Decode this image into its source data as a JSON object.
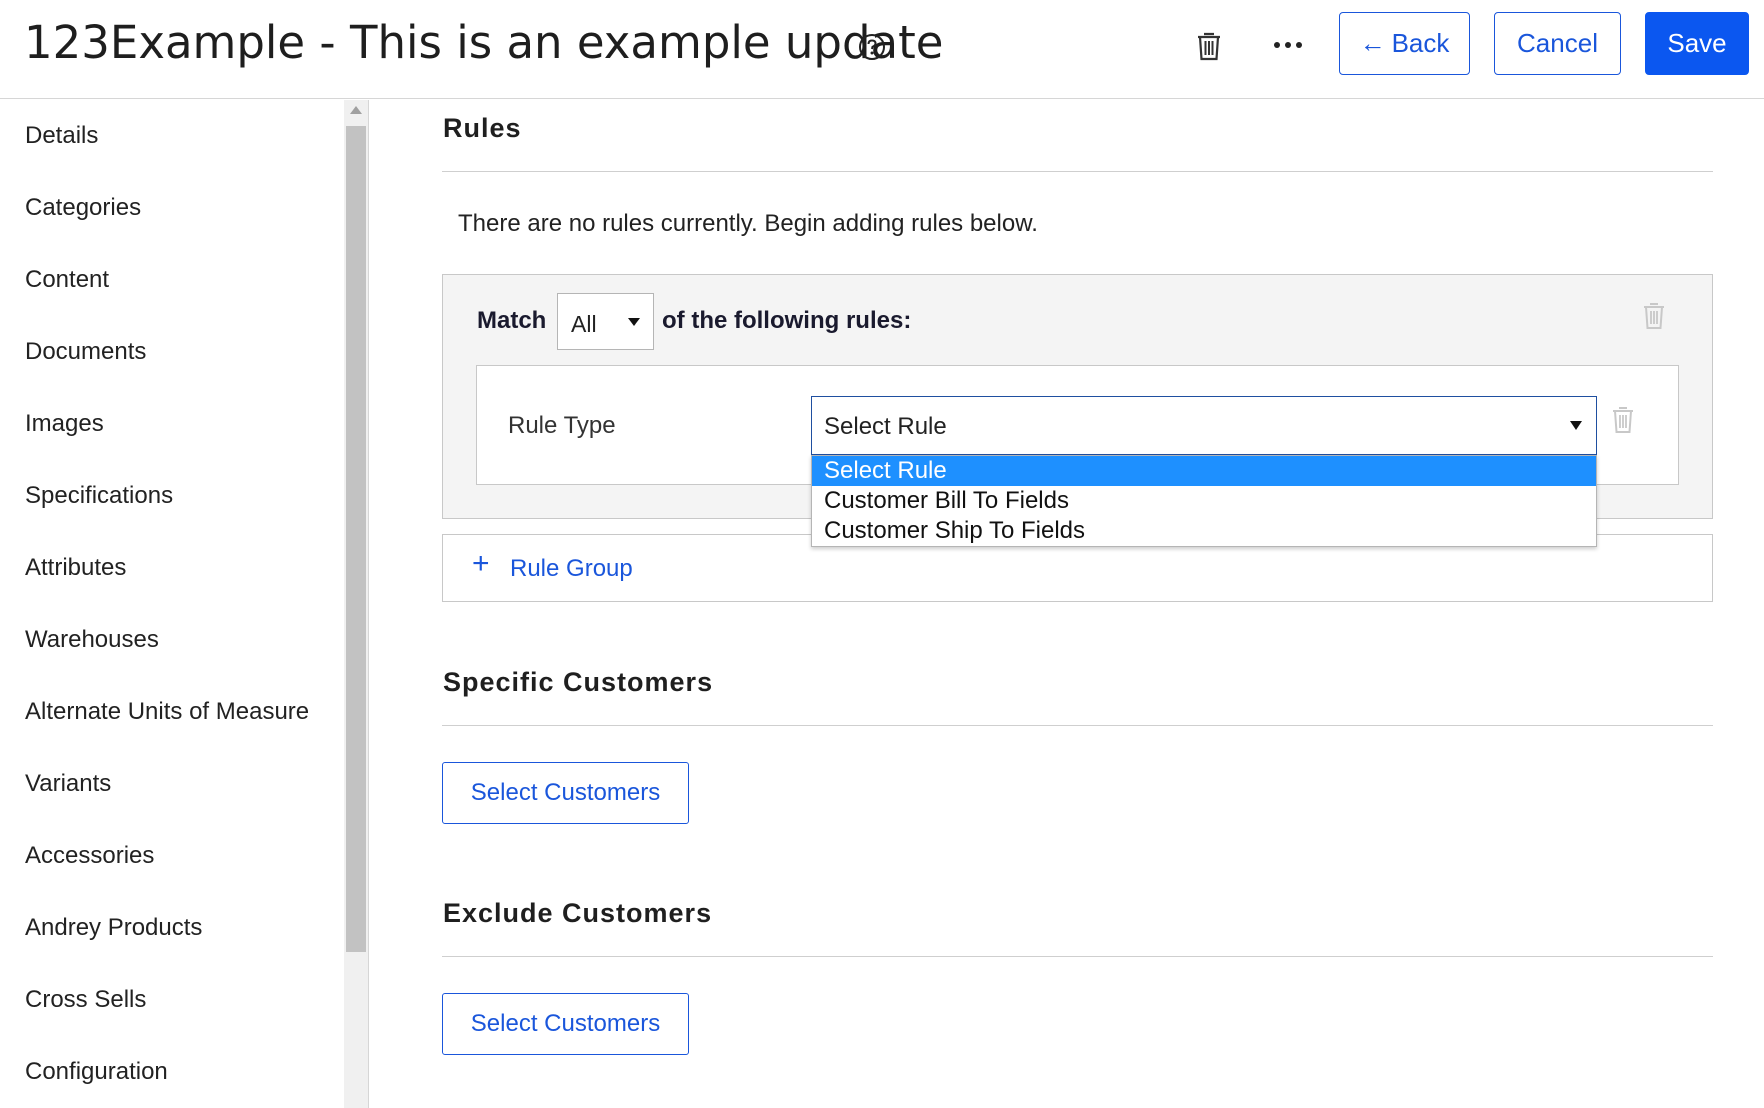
{
  "header": {
    "title": "123Example - This is an example update",
    "help_icon": "question-circle-icon",
    "back_label": "Back",
    "cancel_label": "Cancel",
    "save_label": "Save"
  },
  "sidebar": {
    "items": [
      {
        "label": "Details"
      },
      {
        "label": "Categories"
      },
      {
        "label": "Content"
      },
      {
        "label": "Documents"
      },
      {
        "label": "Images"
      },
      {
        "label": "Specifications"
      },
      {
        "label": "Attributes"
      },
      {
        "label": "Warehouses"
      },
      {
        "label": "Alternate Units of Measure"
      },
      {
        "label": "Variants"
      },
      {
        "label": "Accessories"
      },
      {
        "label": "Andrey Products"
      },
      {
        "label": "Cross Sells"
      },
      {
        "label": "Configuration"
      }
    ]
  },
  "rules": {
    "title": "Rules",
    "empty_message": "There are no rules currently. Begin adding rules below.",
    "match_label": "Match",
    "match_value": "All",
    "following_label": "of the following rules:",
    "rule_type_label": "Rule Type",
    "rule_select_value": "Select Rule",
    "options": [
      "Select Rule",
      "Customer Bill To Fields",
      "Customer Ship To Fields"
    ],
    "add_group_label": "Rule Group"
  },
  "specific_customers": {
    "title": "Specific Customers",
    "button_label": "Select Customers"
  },
  "exclude_customers": {
    "title": "Exclude Customers",
    "button_label": "Select Customers"
  },
  "colors": {
    "accent": "#1a56db",
    "save_bg": "#0b57f0",
    "selected_option": "#1e90ff"
  }
}
